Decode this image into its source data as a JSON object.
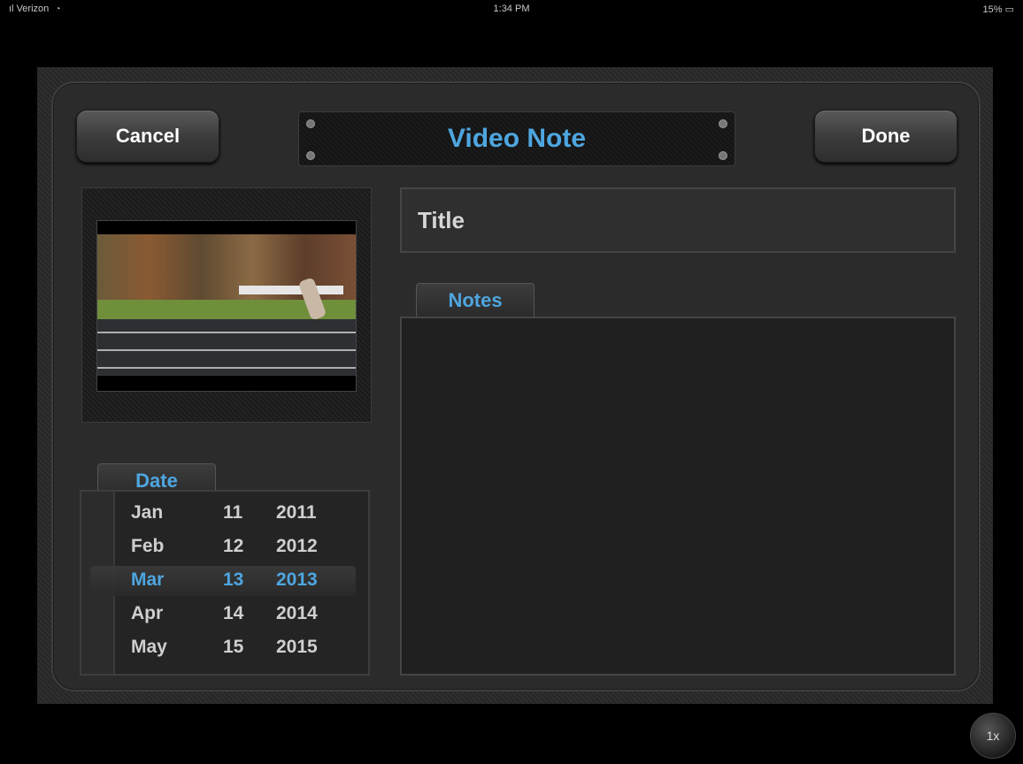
{
  "status_bar": {
    "carrier": "Verizon",
    "time": "1:34 PM",
    "battery": "15%"
  },
  "header": {
    "cancel_label": "Cancel",
    "title": "Video Note",
    "done_label": "Done"
  },
  "title_field": {
    "placeholder": "Title"
  },
  "notes": {
    "tab_label": "Notes",
    "value": ""
  },
  "date_picker": {
    "tab_label": "Date",
    "rows": [
      {
        "month": "Jan",
        "day": "11",
        "year": "2011"
      },
      {
        "month": "Feb",
        "day": "12",
        "year": "2012"
      },
      {
        "month": "Mar",
        "day": "13",
        "year": "2013"
      },
      {
        "month": "Apr",
        "day": "14",
        "year": "2014"
      },
      {
        "month": "May",
        "day": "15",
        "year": "2015"
      }
    ],
    "selected_index": 2
  },
  "playback_speed": "1x",
  "colors": {
    "accent": "#4ea6e0",
    "background": "#2b2b2b"
  },
  "icons": {
    "wifi": "wifi-icon",
    "signal": "signal-icon",
    "battery": "battery-icon"
  }
}
